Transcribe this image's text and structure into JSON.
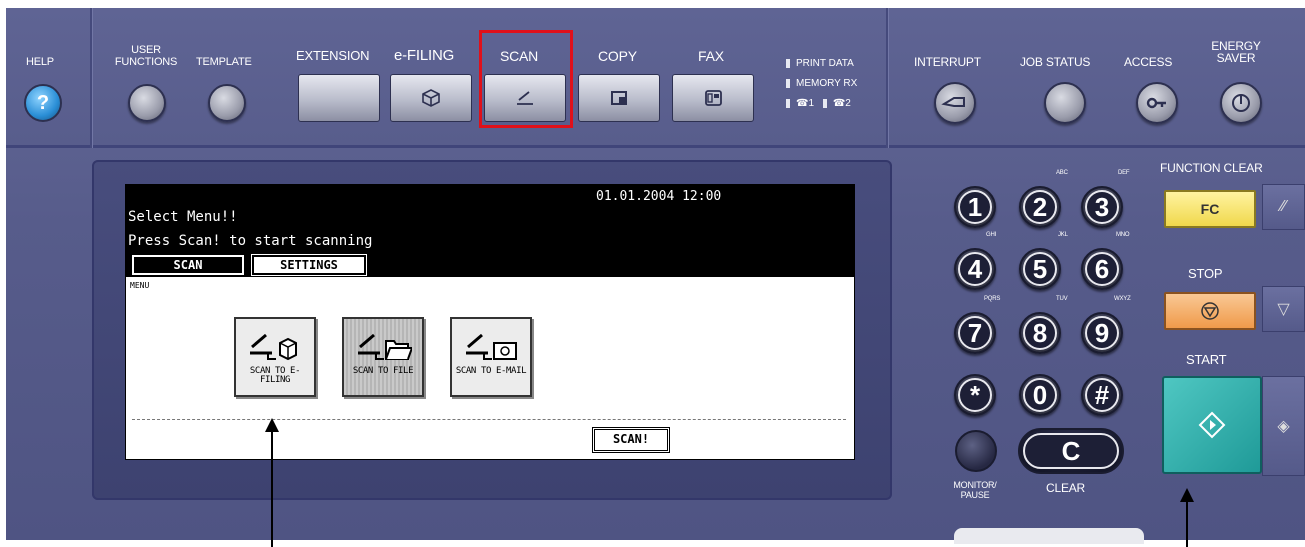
{
  "top_buttons": {
    "help_label": "HELP",
    "user_functions_label": "USER FUNCTIONS",
    "template_label": "TEMPLATE",
    "extension_label": "EXTENSION",
    "efiling_label": "e-FILING",
    "scan_label": "SCAN",
    "copy_label": "COPY",
    "fax_label": "FAX",
    "interrupt_label": "INTERRUPT",
    "job_status_label": "JOB STATUS",
    "access_label": "ACCESS",
    "energy_saver_label": "ENERGY SAVER"
  },
  "indicators": {
    "print_data": "PRINT DATA",
    "memory_rx": "MEMORY RX",
    "line1": "☎1",
    "line2": "☎2"
  },
  "lcd": {
    "datetime": "01.01.2004 12:00",
    "line1": "Select Menu!!",
    "line2": "Press Scan! to start scanning",
    "tab_scan": "SCAN",
    "tab_settings": "SETTINGS",
    "menu_label": "MENU",
    "functions": [
      {
        "label": "SCAN TO E-FILING",
        "selected": false
      },
      {
        "label": "SCAN TO FILE",
        "selected": true
      },
      {
        "label": "SCAN TO E-MAIL",
        "selected": false
      }
    ],
    "scan_button": "SCAN!"
  },
  "keypad": {
    "keys": [
      "1",
      "2",
      "3",
      "4",
      "5",
      "6",
      "7",
      "8",
      "9",
      "*",
      "0",
      "#"
    ],
    "letters": {
      "abc": "ABC",
      "def": "DEF",
      "ghi": "GHI",
      "jkl": "JKL",
      "mno": "MNO",
      "pqrs": "PQRS",
      "tuv": "TUV",
      "wxyz": "WXYZ"
    },
    "monitor_pause_label": "MONITOR/ PAUSE",
    "clear_label": "CLEAR",
    "clear_key": "C"
  },
  "right_panel": {
    "function_clear_label": "FUNCTION CLEAR",
    "fc_key": "FC",
    "stop_label": "STOP",
    "start_label": "START"
  },
  "colors": {
    "panel": "#5a5f8e",
    "highlight_box": "#e0101a",
    "help_button": "#2a8ed6",
    "fc_button": "#f0d84c",
    "stop_button": "#f09a4a",
    "start_button": "#1f9a98"
  }
}
